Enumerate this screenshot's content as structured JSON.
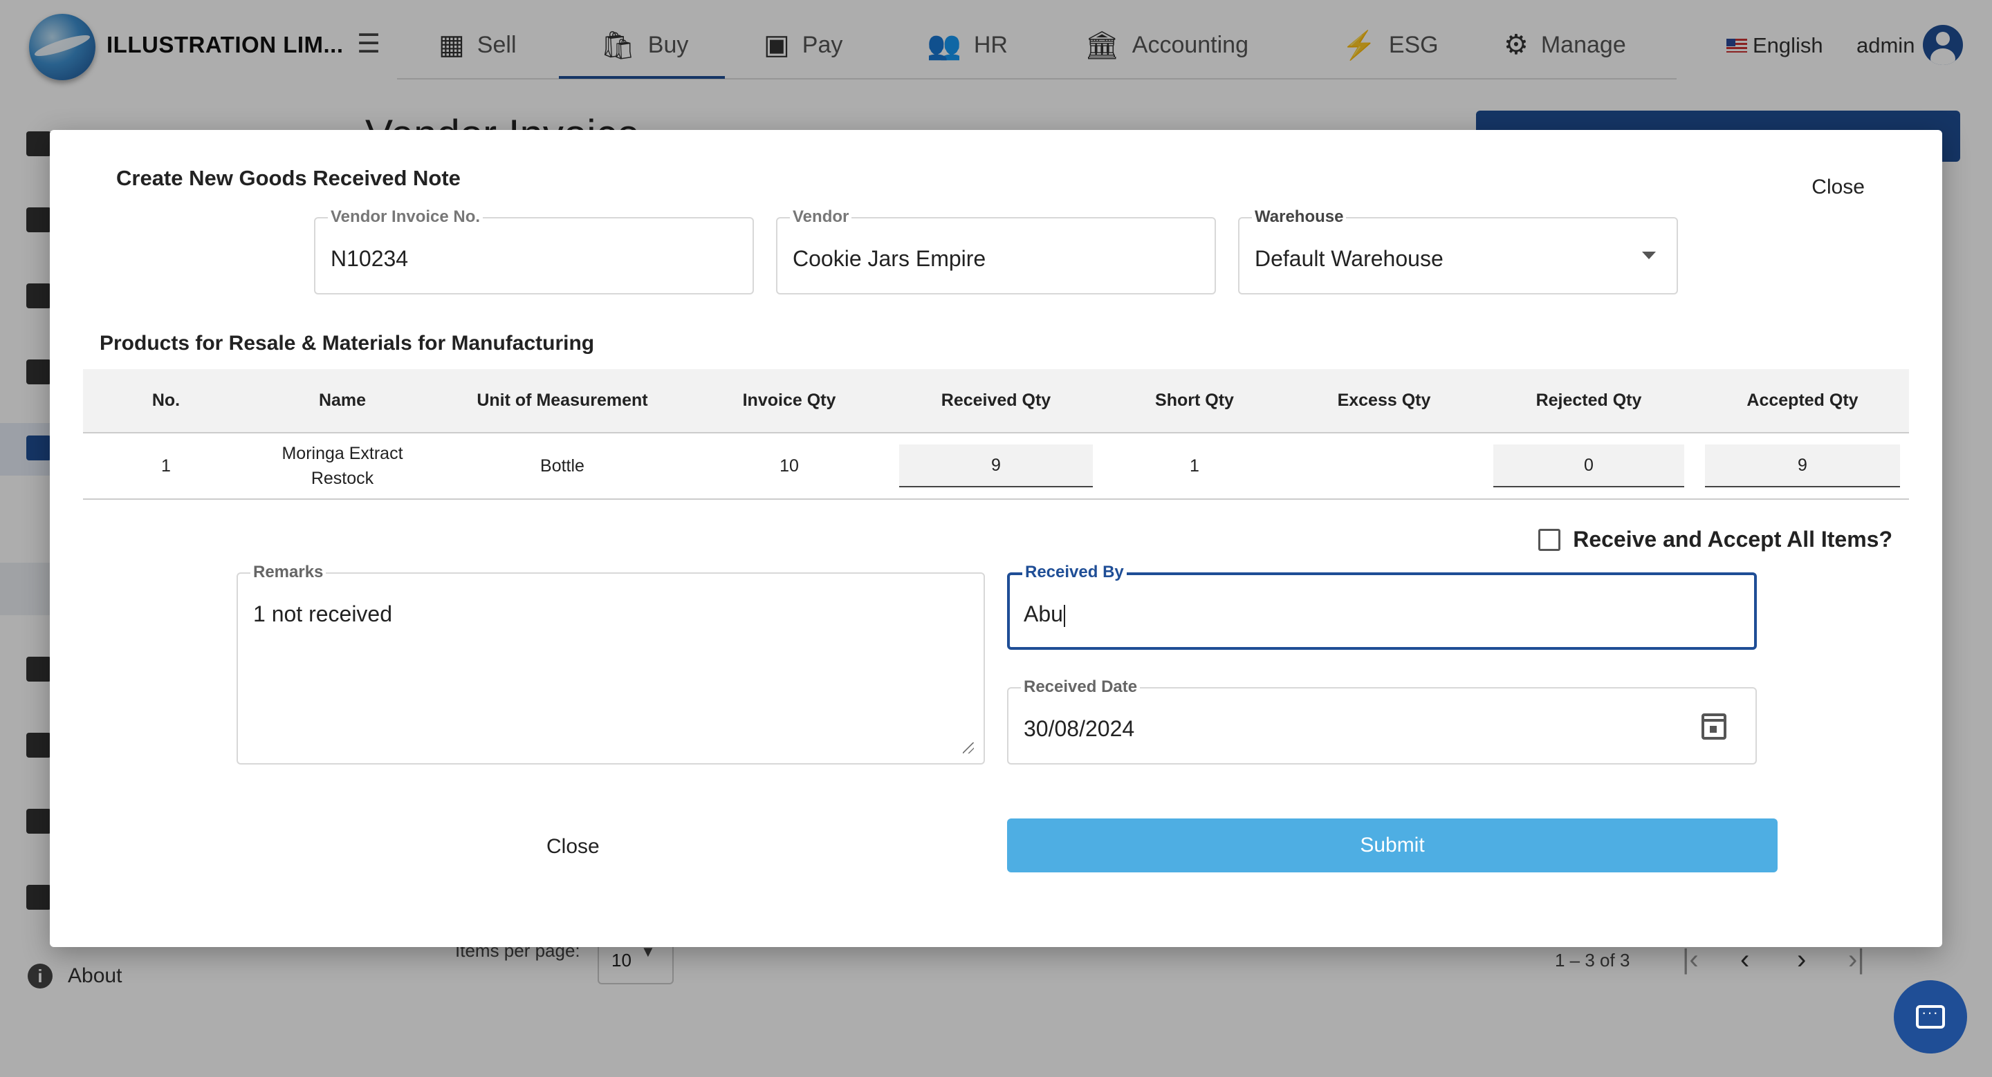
{
  "app": {
    "brand": "ILLUSTRATION LIM...",
    "nav": [
      {
        "label": "Sell",
        "icon": "store-icon"
      },
      {
        "label": "Buy",
        "icon": "shopping-bag-icon"
      },
      {
        "label": "Pay",
        "icon": "money-icon"
      },
      {
        "label": "HR",
        "icon": "people-icon"
      },
      {
        "label": "Accounting",
        "icon": "bank-icon"
      },
      {
        "label": "ESG",
        "icon": "lightning-icon"
      },
      {
        "label": "Manage",
        "icon": "gears-icon"
      }
    ],
    "active_nav": "Buy",
    "language": "English",
    "user": "admin",
    "sidebar_about": "About",
    "page_title": "Vendor Invoice",
    "paginator": {
      "items_per_page_label": "Items per page:",
      "items_per_page_value": "10",
      "range": "1 – 3 of 3"
    },
    "colors": {
      "primary": "#1f4e96",
      "submit": "#4eaee3"
    }
  },
  "dialog": {
    "title": "Create New Goods Received Note",
    "close_top": "Close",
    "fields": {
      "vendor_invoice_no": {
        "label": "Vendor Invoice No.",
        "value": "N10234"
      },
      "vendor": {
        "label": "Vendor",
        "value": "Cookie Jars Empire"
      },
      "warehouse": {
        "label": "Warehouse",
        "value": "Default Warehouse"
      }
    },
    "section_title": "Products for Resale & Materials for Manufacturing",
    "table": {
      "headers": [
        "No.",
        "Name",
        "Unit of Measurement",
        "Invoice Qty",
        "Received Qty",
        "Short Qty",
        "Excess Qty",
        "Rejected Qty",
        "Accepted Qty"
      ],
      "rows": [
        {
          "no": "1",
          "name": "Moringa Extract Restock",
          "unit": "Bottle",
          "invoice_qty": "10",
          "received_qty": "9",
          "short_qty": "1",
          "excess_qty": "",
          "rejected_qty": "0",
          "accepted_qty": "9"
        }
      ]
    },
    "receive_all_label": "Receive and Accept All Items?",
    "receive_all_checked": false,
    "remarks": {
      "label": "Remarks",
      "value": "1 not received"
    },
    "received_by": {
      "label": "Received By",
      "value": "Abu"
    },
    "received_date": {
      "label": "Received Date",
      "value": "30/08/2024"
    },
    "close_bottom": "Close",
    "submit": "Submit"
  }
}
